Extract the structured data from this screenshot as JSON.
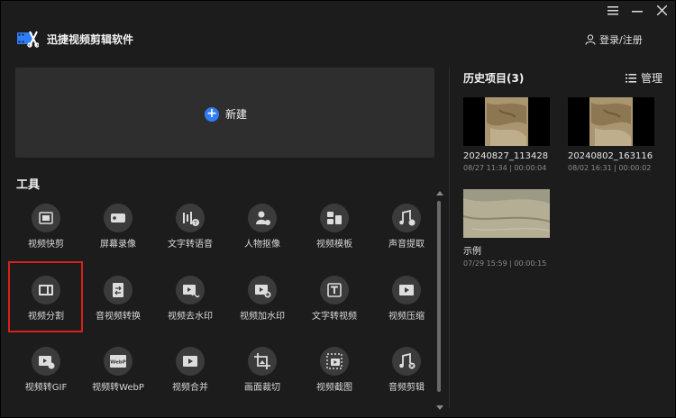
{
  "app": {
    "title": "迅捷视频剪辑软件",
    "login_label": "登录/注册"
  },
  "new_project": {
    "label": "新建"
  },
  "tools": {
    "title": "工具",
    "items": [
      {
        "label": "视频快剪",
        "icon": "film-icon"
      },
      {
        "label": "屏幕录像",
        "icon": "screen-record-icon"
      },
      {
        "label": "文字转语音",
        "icon": "text-to-speech-icon"
      },
      {
        "label": "人物抠像",
        "icon": "person-cutout-icon"
      },
      {
        "label": "视频模板",
        "icon": "template-icon"
      },
      {
        "label": "声音提取",
        "icon": "music-extract-icon"
      },
      {
        "label": "视频分割",
        "icon": "video-split-icon"
      },
      {
        "label": "音视频转换",
        "icon": "convert-icon"
      },
      {
        "label": "视频去水印",
        "icon": "remove-watermark-icon"
      },
      {
        "label": "视频加水印",
        "icon": "add-watermark-icon"
      },
      {
        "label": "文字转视频",
        "icon": "text-to-video-icon"
      },
      {
        "label": "视频压缩",
        "icon": "compress-icon"
      },
      {
        "label": "视频转GIF",
        "icon": "gif-icon"
      },
      {
        "label": "视频转WebP",
        "icon": "webp-icon"
      },
      {
        "label": "视频合并",
        "icon": "merge-icon"
      },
      {
        "label": "画面裁切",
        "icon": "crop-icon"
      },
      {
        "label": "视频截图",
        "icon": "screenshot-icon"
      },
      {
        "label": "音频剪辑",
        "icon": "audio-edit-icon"
      }
    ]
  },
  "history": {
    "title": "历史项目(3)",
    "manage_label": "管理",
    "items": [
      {
        "name": "20240827_113428",
        "meta": "08/27 11:34 | 00:00:04"
      },
      {
        "name": "20240802_163116",
        "meta": "08/02 16:31 | 00:00:02"
      },
      {
        "name": "示例",
        "meta": "07/29 15:59 | 00:00:15"
      }
    ]
  },
  "colors": {
    "accent": "#2f7df6",
    "highlight": "#d9201b",
    "background": "#1c1c1c",
    "panel": "#2e2e2e"
  }
}
